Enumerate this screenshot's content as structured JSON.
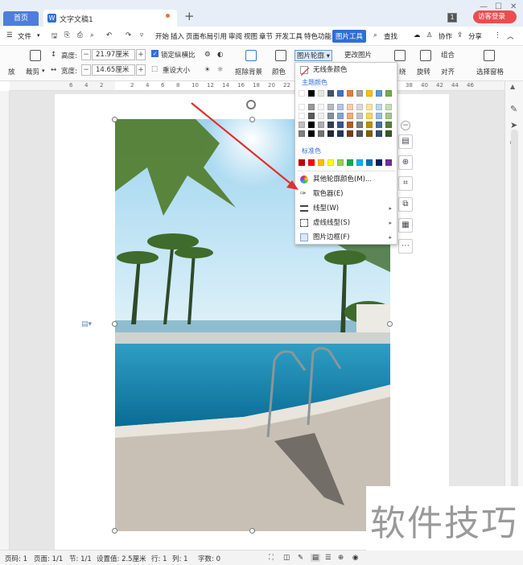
{
  "tabs": {
    "home": "首页",
    "doc": "文字文稿1",
    "new": "+"
  },
  "window": {
    "badge": "1",
    "login": "访客登录"
  },
  "menu": {
    "file": "文件",
    "items": [
      "开始",
      "插入",
      "页面布局",
      "引用",
      "审阅",
      "视图",
      "章节",
      "开发工具",
      "特色功能",
      "图片工具"
    ],
    "search": "查找",
    "collab": "协作",
    "share": "分享"
  },
  "ribbon": {
    "left_cut": "放",
    "crop": "裁剪",
    "height_label": "高度:",
    "height_value": "21.97厘米",
    "width_label": "宽度:",
    "width_value": "14.65厘米",
    "lock_ratio": "锁定纵横比",
    "reset_size": "重设大小",
    "remove_bg": "抠除背景",
    "color": "颜色",
    "outline": "图片轮廓",
    "change_pic": "更改图片",
    "rotate": "旋转",
    "align": "对齐",
    "group": "组合",
    "select_pane": "选择窗格",
    "cut_text": "绕"
  },
  "ruler": {
    "marks": [
      "6",
      "4",
      "2",
      "",
      "2",
      "4",
      "6",
      "8",
      "10",
      "12",
      "14",
      "16",
      "18",
      "20",
      "22",
      "24",
      "26",
      "28",
      "30",
      "32",
      "34",
      "36",
      "38",
      "40",
      "42",
      "44",
      "46"
    ]
  },
  "dropdown": {
    "no_outline": "无线条颜色",
    "theme_colors": "主题颜色",
    "standard_colors": "标准色",
    "more_colors": "其他轮廓颜色(M)...",
    "eyedropper": "取色器(E)",
    "line_style": "线型(W)",
    "dash_style": "虚线线型(S)",
    "pic_border": "图片边框(F)",
    "theme_top": [
      "#ffffff",
      "#000000",
      "#e7e6e6",
      "#44546a",
      "#4472c4",
      "#ed7d31",
      "#a5a5a5",
      "#ffc000",
      "#5b9bd5",
      "#70ad47"
    ],
    "standard": [
      "#c00000",
      "#ff0000",
      "#ffc000",
      "#ffff00",
      "#92d050",
      "#00b050",
      "#00b0f0",
      "#0070c0",
      "#002060",
      "#7030a0"
    ]
  },
  "status": {
    "page": "页码: 1",
    "pages": "页面: 1/1",
    "section": "节: 1/1",
    "setting": "设置值: 2.5厘米",
    "row": "行: 1",
    "col": "列: 1",
    "words": "字数: 0"
  },
  "watermark": "软件技巧",
  "colors": {
    "accent": "#2f6fd6",
    "login": "#e94e4e",
    "arrow": "#e03030"
  }
}
